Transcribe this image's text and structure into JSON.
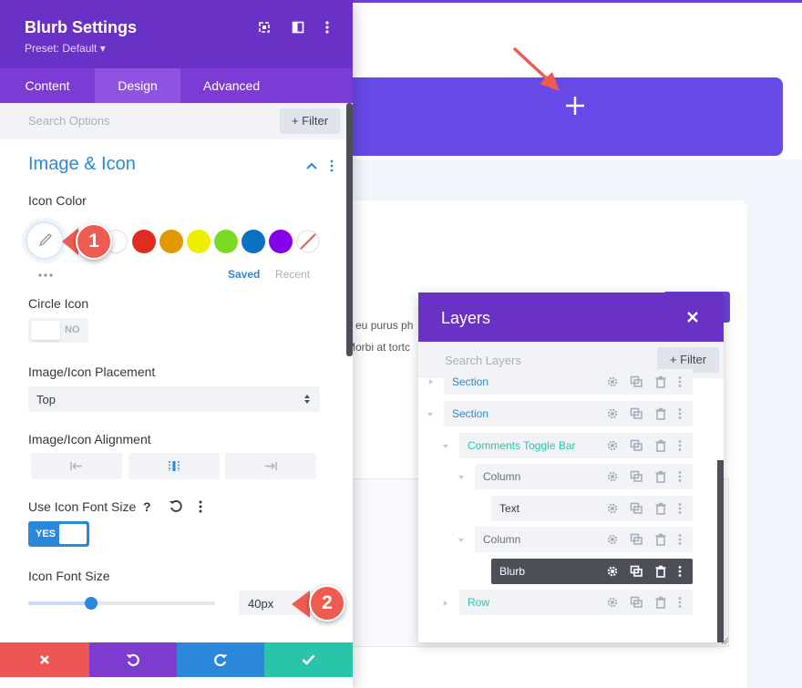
{
  "settings_panel": {
    "title": "Blurb Settings",
    "preset": "Preset: Default ▾",
    "tabs": [
      "Content",
      "Design",
      "Advanced"
    ],
    "active_tab": "Design",
    "search_placeholder": "Search Options",
    "filter_label": "Filter",
    "section_title": "Image & Icon",
    "icon_color": {
      "label": "Icon Color",
      "swatches": [
        "#ffffff",
        "#e02b20",
        "#e09900",
        "#edf000",
        "#7cda24",
        "#0c71c3",
        "#8300e9"
      ],
      "saved_label": "Saved",
      "recent_label": "Recent"
    },
    "circle_icon": {
      "label": "Circle Icon",
      "value": "NO"
    },
    "placement": {
      "label": "Image/Icon Placement",
      "value": "Top"
    },
    "alignment": {
      "label": "Image/Icon Alignment"
    },
    "use_icon_font_size": {
      "label": "Use Icon Font Size",
      "value": "YES"
    },
    "icon_font_size": {
      "label": "Icon Font Size",
      "value": "40px",
      "slider_fraction": 0.34
    },
    "colors": {
      "header": "#6a31c6",
      "tabs": "#7c3bd4",
      "accent": "#2b87da",
      "cancel": "#ef5555",
      "undo": "#7e3bd0",
      "redo": "#2b87da",
      "save": "#29c4a9"
    }
  },
  "callouts": {
    "one": "1",
    "two": "2"
  },
  "background": {
    "text_line1": "a eu purus ph",
    "text_line2": "Morbi at tortc"
  },
  "layers_panel": {
    "title": "Layers",
    "search_placeholder": "Search Layers",
    "filter_label": "Filter",
    "rows": [
      {
        "label": "Section"
      },
      {
        "label": "Section"
      },
      {
        "label": "Comments Toggle Bar"
      },
      {
        "label": "Column"
      },
      {
        "label": "Text"
      },
      {
        "label": "Column"
      },
      {
        "label": "Blurb"
      },
      {
        "label": "Row"
      }
    ]
  }
}
